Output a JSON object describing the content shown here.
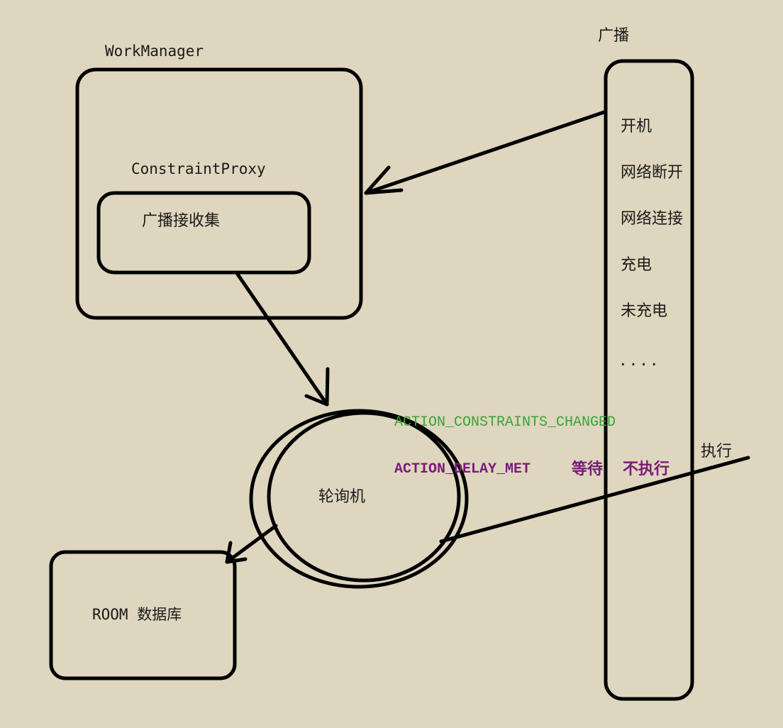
{
  "workmanager": {
    "title": "WorkManager",
    "proxy_label": "ConstraintProxy",
    "receiver_label": "广播接收集"
  },
  "broadcast": {
    "title": "广播",
    "items": [
      "开机",
      "网络断开",
      "网络连接",
      "充电",
      "未充电",
      "...."
    ]
  },
  "poller": {
    "label": "轮询机",
    "action_constraints": "ACTION_CONSTRAINTS_CHANGED",
    "action_delay": "ACTION_DELAY_MET",
    "wait_label": "等待",
    "no_exec_label": "不执行",
    "exec_label": "执行"
  },
  "database": {
    "label": "ROOM 数据库"
  },
  "colors": {
    "background": "#ded6be",
    "stroke": "#000000",
    "constraints_text": "#3aa23a",
    "delay_text": "#7a1a78"
  }
}
